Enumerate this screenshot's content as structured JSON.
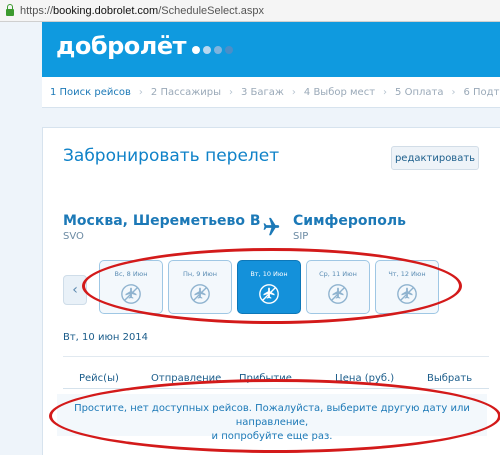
{
  "browser": {
    "url_scheme": "https://",
    "url_host": "booking.dobrolet.com",
    "url_path": "/ScheduleSelect.aspx"
  },
  "header": {
    "logo": "добролёт",
    "dot_colors": [
      "#ffffff",
      "#b9d8f0",
      "#7fb4de",
      "#4a8ec8"
    ]
  },
  "steps": [
    {
      "label": "1 Поиск рейсов"
    },
    {
      "label": "2 Пассажиры"
    },
    {
      "label": "3 Багаж"
    },
    {
      "label": "4 Выбор мест"
    },
    {
      "label": "5 Оплата"
    },
    {
      "label": "6 Подт"
    }
  ],
  "booking": {
    "title": "Забронировать перелет",
    "edit_label": "редактировать",
    "origin_city": "Москва, Шереметьево В",
    "origin_code": "SVO",
    "destination_city": "Симферополь",
    "destination_code": "SIP"
  },
  "dates": [
    {
      "label": "Вс, 8 Июн",
      "icon": "no-flights-icon",
      "selected": false
    },
    {
      "label": "Пн, 9 Июн",
      "icon": "no-flights-icon",
      "selected": false
    },
    {
      "label": "Вт, 10 Июн",
      "icon": "no-flights-icon",
      "selected": true
    },
    {
      "label": "Ср, 11 Июн",
      "icon": "no-flights-icon",
      "selected": false
    },
    {
      "label": "Чт, 12 Июн",
      "icon": "no-flights-icon",
      "selected": false
    }
  ],
  "selected_date_text": "Вт, 10 июн 2014",
  "table": {
    "headers": [
      "Рейс(ы)",
      "Отправление",
      "Прибытие",
      "Цена (руб.)",
      "Выбрать"
    ]
  },
  "message": {
    "line1": "Простите, нет доступных рейсов. Пожалуйста, выберите другую дату или направление,",
    "line2": "и попробуйте еще раз."
  },
  "colors": {
    "brand_blue": "#0f9adf",
    "annotation_red": "#d31a1a"
  }
}
